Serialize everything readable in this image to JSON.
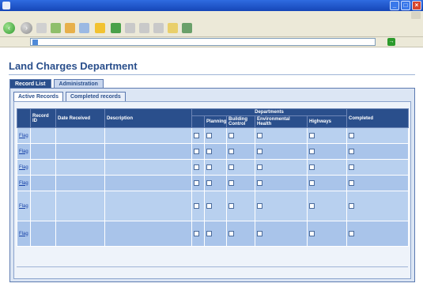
{
  "window": {
    "title": ""
  },
  "menu": {
    "items": [
      "",
      "",
      "",
      "",
      "",
      ""
    ]
  },
  "toolbar": {
    "back_label": "",
    "search_label": "",
    "favorites_label": ""
  },
  "address": {
    "label": "",
    "url": "",
    "go_label": ""
  },
  "page": {
    "title": "Land Charges Department",
    "top_links": ""
  },
  "tabs": {
    "primary": [
      "Record List",
      "Administration"
    ],
    "secondary": [
      "Active Records",
      "Completed records"
    ]
  },
  "table": {
    "headers": {
      "col0": "",
      "record_id": "Record ID",
      "date_received": "Date Received",
      "description": "Description",
      "departments": "Departments",
      "planning": "Planning",
      "building_control": "Building Control",
      "environmental_health": "Environmental Health",
      "highways": "Highways",
      "completed": "Completed",
      "dept_first": ""
    },
    "rows": [
      {
        "flag": "Flag",
        "id": "",
        "date": "",
        "desc": ""
      },
      {
        "flag": "Flag",
        "id": "",
        "date": "",
        "desc": ""
      },
      {
        "flag": "Flag",
        "id": "",
        "date": "",
        "desc": ""
      },
      {
        "flag": "Flag",
        "id": "",
        "date": "",
        "desc": ""
      },
      {
        "flag": "Flag",
        "id": "",
        "date": "",
        "desc": ""
      },
      {
        "flag": "Flag",
        "id": "",
        "date": "",
        "desc": ""
      }
    ]
  },
  "pager": {
    "nav": "",
    "records": "",
    "total": ""
  },
  "branding": {
    "logo": ""
  }
}
